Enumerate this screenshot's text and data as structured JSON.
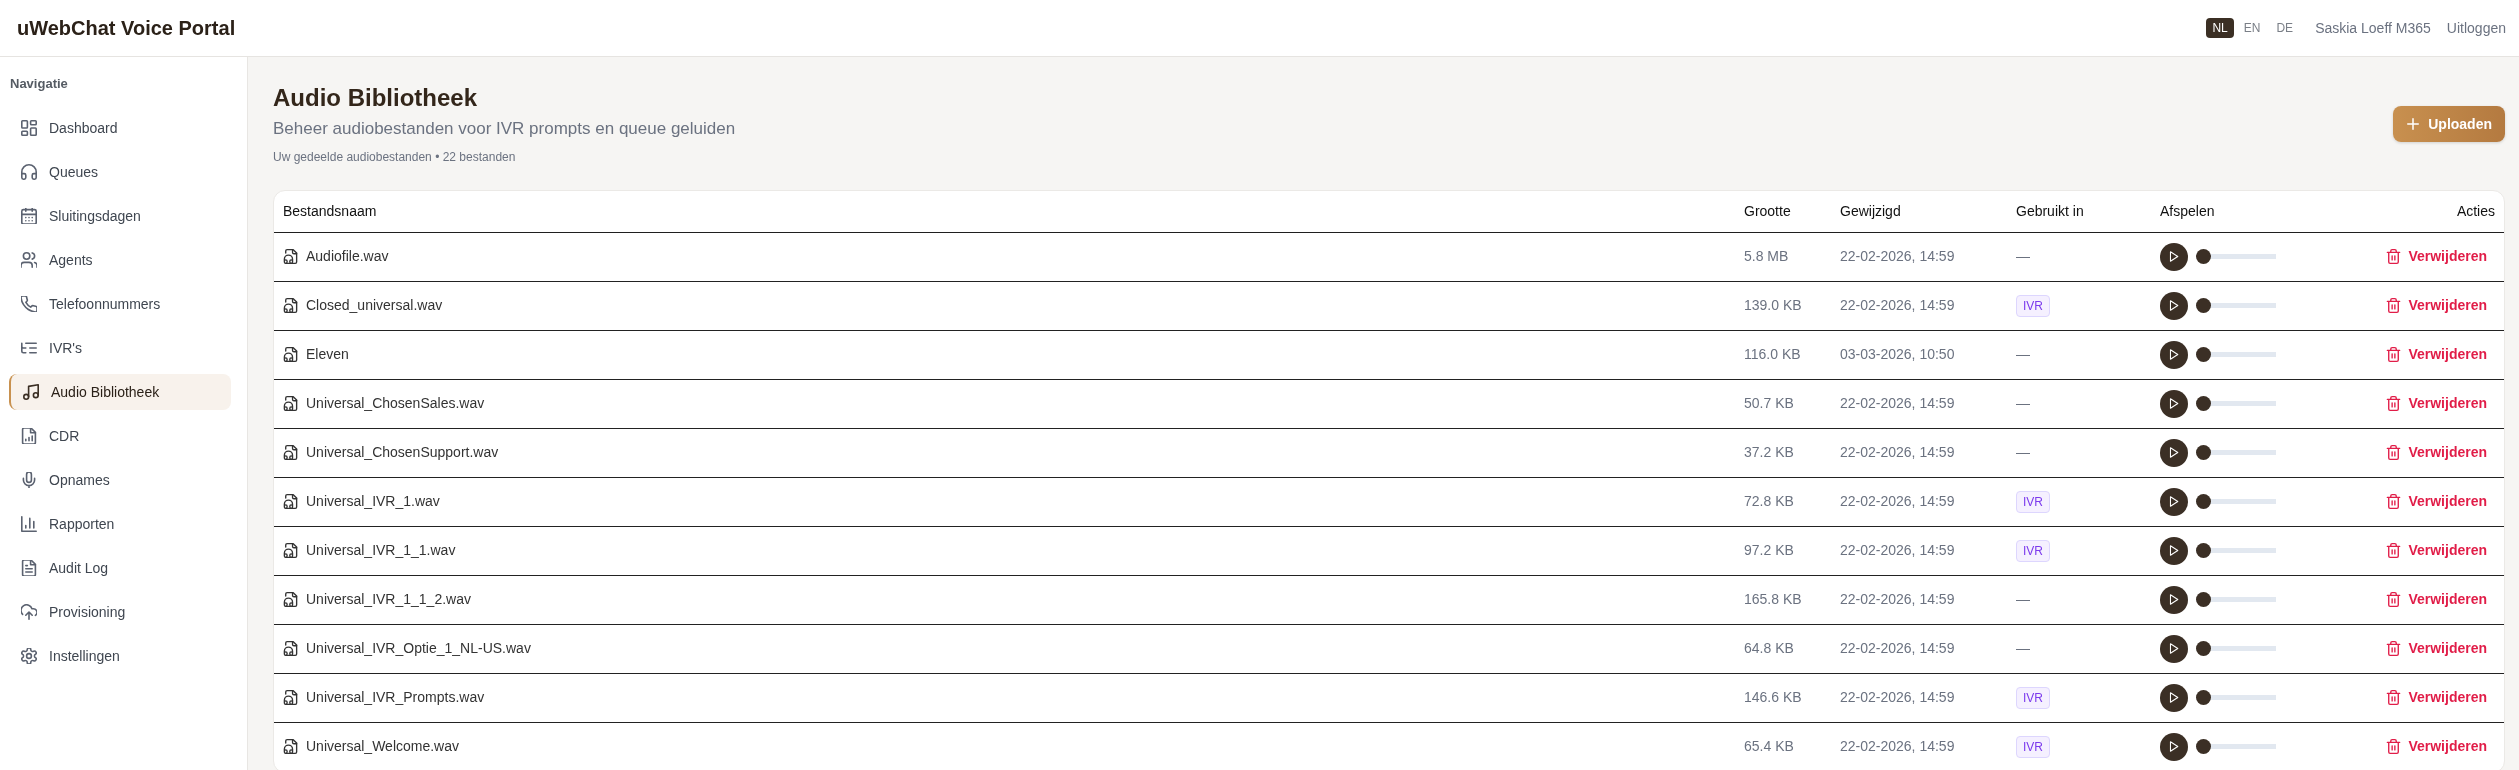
{
  "header": {
    "title": "uWebChat Voice Portal",
    "languages": [
      {
        "label": "NL",
        "selected": true
      },
      {
        "label": "EN",
        "selected": false
      },
      {
        "label": "DE",
        "selected": false
      }
    ],
    "user": "Saskia Loeff M365",
    "logout": "Uitloggen"
  },
  "sidebar": {
    "heading": "Navigatie",
    "items": [
      {
        "label": "Dashboard",
        "selected": false
      },
      {
        "label": "Queues",
        "selected": false
      },
      {
        "label": "Sluitingsdagen",
        "selected": false
      },
      {
        "label": "Agents",
        "selected": false
      },
      {
        "label": "Telefoonnummers",
        "selected": false
      },
      {
        "label": "IVR's",
        "selected": false
      },
      {
        "label": "Audio Bibliotheek",
        "selected": true
      },
      {
        "label": "CDR",
        "selected": false
      },
      {
        "label": "Opnames",
        "selected": false
      },
      {
        "label": "Rapporten",
        "selected": false
      },
      {
        "label": "Audit Log",
        "selected": false
      },
      {
        "label": "Provisioning",
        "selected": false
      },
      {
        "label": "Instellingen",
        "selected": false
      }
    ]
  },
  "page": {
    "title": "Audio Bibliotheek",
    "subtitle": "Beheer audiobestanden voor IVR prompts en queue geluiden",
    "summary": "Uw gedeelde audiobestanden • 22 bestanden",
    "upload_button": "Uploaden"
  },
  "table": {
    "columns": [
      "Bestandsnaam",
      "Grootte",
      "Gewijzigd",
      "Gebruikt in",
      "Afspelen",
      "Acties"
    ],
    "rows": [
      {
        "name": "Audiofile.wav",
        "size": "5.8 MB",
        "modified": "22-02-2026, 14:59",
        "usage": {
          "kind": "dash",
          "text": "—"
        },
        "level": 0,
        "action": "Verwijderen"
      },
      {
        "name": "Closed_universal.wav",
        "size": "139.0 KB",
        "modified": "22-02-2026, 14:59",
        "usage": {
          "kind": "badge",
          "text": "IVR"
        },
        "level": 0,
        "action": "Verwijderen"
      },
      {
        "name": "Eleven",
        "size": "116.0 KB",
        "modified": "03-03-2026, 10:50",
        "usage": {
          "kind": "dash",
          "text": "—"
        },
        "level": 0,
        "action": "Verwijderen"
      },
      {
        "name": "Universal_ChosenSales.wav",
        "size": "50.7 KB",
        "modified": "22-02-2026, 14:59",
        "usage": {
          "kind": "dash",
          "text": "—"
        },
        "level": 0,
        "action": "Verwijderen"
      },
      {
        "name": "Universal_ChosenSupport.wav",
        "size": "37.2 KB",
        "modified": "22-02-2026, 14:59",
        "usage": {
          "kind": "dash",
          "text": "—"
        },
        "level": 0,
        "action": "Verwijderen"
      },
      {
        "name": "Universal_IVR_1.wav",
        "size": "72.8 KB",
        "modified": "22-02-2026, 14:59",
        "usage": {
          "kind": "badge",
          "text": "IVR"
        },
        "level": 0,
        "action": "Verwijderen"
      },
      {
        "name": "Universal_IVR_1_1.wav",
        "size": "97.2 KB",
        "modified": "22-02-2026, 14:59",
        "usage": {
          "kind": "badge",
          "text": "IVR"
        },
        "level": 0,
        "action": "Verwijderen"
      },
      {
        "name": "Universal_IVR_1_1_2.wav",
        "size": "165.8 KB",
        "modified": "22-02-2026, 14:59",
        "usage": {
          "kind": "dash",
          "text": "—"
        },
        "level": 0,
        "action": "Verwijderen"
      },
      {
        "name": "Universal_IVR_Optie_1_NL-US.wav",
        "size": "64.8 KB",
        "modified": "22-02-2026, 14:59",
        "usage": {
          "kind": "dash",
          "text": "—"
        },
        "level": 0,
        "action": "Verwijderen"
      },
      {
        "name": "Universal_IVR_Prompts.wav",
        "size": "146.6 KB",
        "modified": "22-02-2026, 14:59",
        "usage": {
          "kind": "badge",
          "text": "IVR"
        },
        "level": 0,
        "action": "Verwijderen"
      },
      {
        "name": "Universal_Welcome.wav",
        "size": "65.4 KB",
        "modified": "22-02-2026, 14:59",
        "usage": {
          "kind": "badge",
          "text": "IVR"
        },
        "level": 0,
        "action": "Verwijderen"
      }
    ]
  }
}
